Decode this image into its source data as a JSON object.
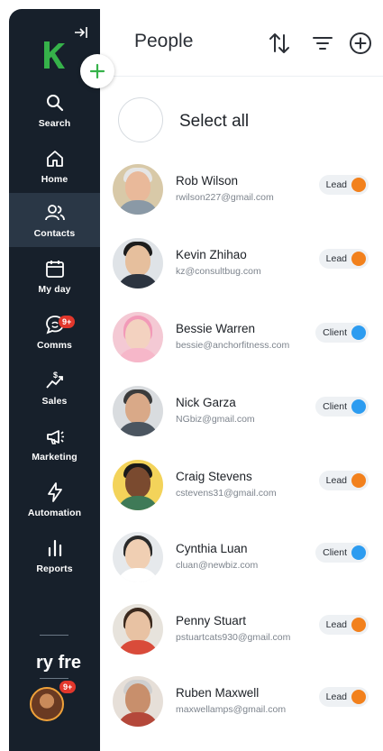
{
  "header": {
    "title": "People",
    "sort_icon": "sort-arrows-icon",
    "filter_icon": "filter-icon",
    "add_icon": "add-circle-icon"
  },
  "select_all": {
    "label": "Select all"
  },
  "sidebar": {
    "logo": "keap-logo",
    "items": [
      {
        "label": "Search",
        "icon": "search-icon"
      },
      {
        "label": "Home",
        "icon": "home-icon"
      },
      {
        "label": "Contacts",
        "icon": "contacts-icon",
        "active": true
      },
      {
        "label": "My day",
        "icon": "calendar-icon"
      },
      {
        "label": "Comms",
        "icon": "chat-icon",
        "badge": "9+"
      },
      {
        "label": "Sales",
        "icon": "sales-icon"
      },
      {
        "label": "Marketing",
        "icon": "megaphone-icon"
      },
      {
        "label": "Automation",
        "icon": "lightning-icon"
      },
      {
        "label": "Reports",
        "icon": "bar-chart-icon"
      }
    ],
    "try_free": "ry fre",
    "avatar_badge": "9+"
  },
  "contacts": [
    {
      "name": "Rob Wilson",
      "email": "rwilson227@gmail.com",
      "status": "Lead",
      "status_color": "#f2811d"
    },
    {
      "name": "Kevin Zhihao",
      "email": "kz@consultbug.com",
      "status": "Lead",
      "status_color": "#f2811d"
    },
    {
      "name": "Bessie Warren",
      "email": "bessie@anchorfitness.com",
      "status": "Client",
      "status_color": "#2d9cf0"
    },
    {
      "name": "Nick Garza",
      "email": "NGbiz@gmail.com",
      "status": "Client",
      "status_color": "#2d9cf0"
    },
    {
      "name": "Craig Stevens",
      "email": "cstevens31@gmail.com",
      "status": "Lead",
      "status_color": "#f2811d"
    },
    {
      "name": "Cynthia Luan",
      "email": "cluan@newbiz.com",
      "status": "Client",
      "status_color": "#2d9cf0"
    },
    {
      "name": "Penny Stuart",
      "email": "pstuartcats930@gmail.com",
      "status": "Lead",
      "status_color": "#f2811d"
    },
    {
      "name": "Ruben Maxwell",
      "email": "maxwellamps@gmail.com",
      "status": "Lead",
      "status_color": "#f2811d"
    }
  ],
  "colors": {
    "sidebar": "#17202b",
    "sidebar_active": "#2a3746",
    "brand_green": "#36b24a"
  }
}
